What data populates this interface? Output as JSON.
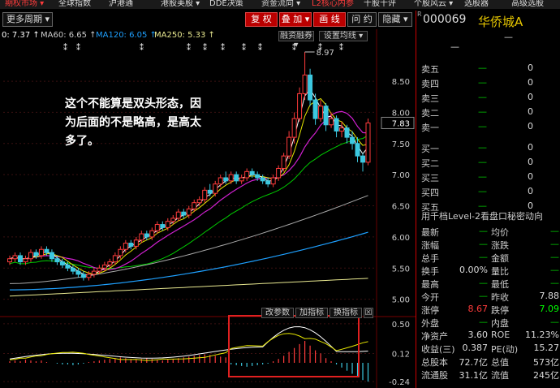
{
  "menu": [
    "期权市场 ▾",
    "全球指数",
    "沪港通",
    "港股美股 ▾",
    "DDE决策",
    "资金流向 ▾",
    "L2核心内参",
    "千股千评",
    "个股风云 ▾",
    "选股器",
    "高级选股"
  ],
  "toolbar": {
    "period": "更多周期 ▾",
    "restore": "复 权",
    "overlay": "叠 加 ▾",
    "draw": "画 线",
    "ask": "问 约",
    "hide": "隐藏 ▾"
  },
  "ma_legend": [
    {
      "label": "0: 7.37 ↑",
      "color": "#ffffff"
    },
    {
      "label": "MA60: 6.65 ↑",
      "color": "#cccccc"
    },
    {
      "label": "MA120: 6.05 ↑",
      "color": "#1ea0ff"
    },
    {
      "label": "MA250: 5.33 ↑",
      "color": "#e8e890"
    }
  ],
  "chart_buttons": {
    "margin": "融资融券 ▾",
    "ma_setting": "设置均线 ▾"
  },
  "sub_buttons": {
    "change_param": "改参数",
    "add_indicator": "加指标",
    "switch_indicator": "换指标",
    "close": "☒"
  },
  "chart_data": {
    "type": "candlestick",
    "price_axis_ticks": [
      8.5,
      8.0,
      7.5,
      7.0,
      6.5,
      6.0,
      5.5,
      5.0
    ],
    "current_price_label": "7.83",
    "high_label": "8.97",
    "macd_axis_ticks": [
      0.5,
      0.12,
      -0.24
    ],
    "candles": [
      [
        5.6,
        5.65,
        5.55,
        5.7
      ],
      [
        5.65,
        5.7,
        5.6,
        5.75
      ],
      [
        5.7,
        5.6,
        5.55,
        5.75
      ],
      [
        5.6,
        5.65,
        5.55,
        5.7
      ],
      [
        5.65,
        5.75,
        5.6,
        5.8
      ],
      [
        5.75,
        5.7,
        5.65,
        5.8
      ],
      [
        5.7,
        5.8,
        5.65,
        5.85
      ],
      [
        5.8,
        5.75,
        5.7,
        5.85
      ],
      [
        5.75,
        5.65,
        5.6,
        5.8
      ],
      [
        5.65,
        5.6,
        5.55,
        5.7
      ],
      [
        5.6,
        5.55,
        5.5,
        5.65
      ],
      [
        5.55,
        5.5,
        5.45,
        5.6
      ],
      [
        5.5,
        5.45,
        5.4,
        5.55
      ],
      [
        5.45,
        5.4,
        5.35,
        5.5
      ],
      [
        5.4,
        5.35,
        5.3,
        5.45
      ],
      [
        5.35,
        5.4,
        5.3,
        5.45
      ],
      [
        5.4,
        5.45,
        5.35,
        5.5
      ],
      [
        5.45,
        5.5,
        5.4,
        5.55
      ],
      [
        5.5,
        5.55,
        5.45,
        5.6
      ],
      [
        5.55,
        5.6,
        5.5,
        5.65
      ],
      [
        5.6,
        5.7,
        5.55,
        5.75
      ],
      [
        5.7,
        5.8,
        5.65,
        5.85
      ],
      [
        5.8,
        5.9,
        5.75,
        5.95
      ],
      [
        5.9,
        5.85,
        5.8,
        5.95
      ],
      [
        5.85,
        5.95,
        5.8,
        6.0
      ],
      [
        5.95,
        6.05,
        5.9,
        6.1
      ],
      [
        6.05,
        6.0,
        5.95,
        6.1
      ],
      [
        6.0,
        6.1,
        5.95,
        6.15
      ],
      [
        6.1,
        6.2,
        6.05,
        6.25
      ],
      [
        6.2,
        6.15,
        6.1,
        6.25
      ],
      [
        6.15,
        6.25,
        6.1,
        6.3
      ],
      [
        6.25,
        6.3,
        6.2,
        6.35
      ],
      [
        6.3,
        6.4,
        6.25,
        6.45
      ],
      [
        6.4,
        6.35,
        6.3,
        6.45
      ],
      [
        6.35,
        6.45,
        6.3,
        6.5
      ],
      [
        6.45,
        6.55,
        6.4,
        6.6
      ],
      [
        6.55,
        6.6,
        6.5,
        6.65
      ],
      [
        6.6,
        6.75,
        6.55,
        6.8
      ],
      [
        6.75,
        6.7,
        6.65,
        6.85
      ],
      [
        6.7,
        6.85,
        6.65,
        6.9
      ],
      [
        6.85,
        6.95,
        6.8,
        7.0
      ],
      [
        6.95,
        6.9,
        6.85,
        7.05
      ],
      [
        6.9,
        7.0,
        6.85,
        7.05
      ],
      [
        7.0,
        6.9,
        6.85,
        7.05
      ],
      [
        6.9,
        6.95,
        6.85,
        7.0
      ],
      [
        6.95,
        7.05,
        6.9,
        7.1
      ],
      [
        7.05,
        7.0,
        6.95,
        7.1
      ],
      [
        7.0,
        6.95,
        6.9,
        7.05
      ],
      [
        6.95,
        6.9,
        6.85,
        7.0
      ],
      [
        6.9,
        6.85,
        6.8,
        6.95
      ],
      [
        6.85,
        6.95,
        6.8,
        7.0
      ],
      [
        6.95,
        7.1,
        6.9,
        7.15
      ],
      [
        7.1,
        7.3,
        7.05,
        7.35
      ],
      [
        7.3,
        7.6,
        7.25,
        7.7
      ],
      [
        7.6,
        7.9,
        7.5,
        8.0
      ],
      [
        7.9,
        8.3,
        7.85,
        8.4
      ],
      [
        8.3,
        8.6,
        8.2,
        8.97
      ],
      [
        8.6,
        8.2,
        8.1,
        8.7
      ],
      [
        8.2,
        7.9,
        7.8,
        8.3
      ],
      [
        7.9,
        8.1,
        7.85,
        8.2
      ],
      [
        8.1,
        7.8,
        7.7,
        8.15
      ],
      [
        7.8,
        7.9,
        7.75,
        8.0
      ],
      [
        7.9,
        7.7,
        7.6,
        7.95
      ],
      [
        7.7,
        7.75,
        7.6,
        7.85
      ],
      [
        7.75,
        7.6,
        7.5,
        7.8
      ],
      [
        7.6,
        7.5,
        7.4,
        7.7
      ],
      [
        7.5,
        7.3,
        7.2,
        7.6
      ],
      [
        7.3,
        7.2,
        7.05,
        7.35
      ],
      [
        7.2,
        7.83,
        7.15,
        7.9
      ]
    ],
    "macd_bars": [
      0.02,
      0.03,
      0.02,
      0.04,
      0.03,
      0.02,
      0.03,
      0.01,
      0.0,
      -0.01,
      -0.02,
      -0.02,
      -0.03,
      -0.02,
      -0.01,
      0.01,
      0.02,
      0.03,
      0.04,
      0.05,
      0.06,
      0.07,
      0.06,
      0.05,
      0.04,
      0.05,
      0.06,
      0.05,
      0.04,
      0.03,
      0.04,
      0.05,
      0.06,
      0.07,
      0.08,
      0.09,
      0.1,
      0.11,
      0.1,
      0.09,
      0.08,
      0.07,
      -0.02,
      -0.03,
      -0.04,
      -0.05,
      -0.04,
      -0.03,
      -0.02,
      -0.01,
      0.02,
      0.05,
      0.09,
      0.14,
      0.19,
      0.24,
      0.28,
      0.22,
      0.16,
      0.12,
      0.06,
      0.02,
      -0.02,
      -0.06,
      -0.1,
      -0.14,
      -0.18,
      -0.22,
      -0.24
    ]
  },
  "annotation": "这个不能算是双头形态，因为后面的不是略高，是高太多了。",
  "quote": {
    "code_prefix": "R",
    "code": "000069",
    "name": "华侨城A",
    "dash": "—",
    "order_book": [
      {
        "label": "卖五",
        "dash": "—",
        "value": "0"
      },
      {
        "label": "卖四",
        "dash": "—",
        "value": "0"
      },
      {
        "label": "卖三",
        "dash": "—",
        "value": "0"
      },
      {
        "label": "卖二",
        "dash": "—",
        "value": "0"
      },
      {
        "label": "卖一",
        "dash": "—",
        "value": "0"
      },
      {
        "label": "买一",
        "dash": "—",
        "value": "0"
      },
      {
        "label": "买二",
        "dash": "—",
        "value": "0"
      },
      {
        "label": "买三",
        "dash": "—",
        "value": "0"
      },
      {
        "label": "买四",
        "dash": "—",
        "value": "0"
      },
      {
        "label": "买五",
        "dash": "—",
        "value": "0"
      }
    ],
    "l2_link": "用千档Level-2看盘口秘密动向",
    "stats": [
      {
        "a": "最新",
        "av": "—",
        "b": "均价",
        "bv": "—"
      },
      {
        "a": "涨幅",
        "av": "—",
        "b": "涨跌",
        "bv": "—"
      },
      {
        "a": "总手",
        "av": "—",
        "b": "金额",
        "bv": "—"
      },
      {
        "a": "换手",
        "av": "0.00%",
        "b": "量比",
        "bv": "—"
      },
      {
        "a": "最高",
        "av": "—",
        "b": "最低",
        "bv": "—"
      },
      {
        "a": "今开",
        "av": "—",
        "b": "昨收",
        "bv": "7.88"
      },
      {
        "a": "涨停",
        "av": "8.67",
        "b": "跌停",
        "bv": "7.09"
      },
      {
        "a": "外盘",
        "av": "—",
        "b": "内盘",
        "bv": "—"
      },
      {
        "a": "净资产",
        "av": "3.60",
        "b": "ROE",
        "bv": "11.23%"
      },
      {
        "a": "收益(三)",
        "av": "0.387",
        "b": "PE(动)",
        "bv": "15.27"
      },
      {
        "a": "总股本",
        "av": "72.7亿",
        "b": "总值",
        "bv": "573亿"
      },
      {
        "a": "流通股",
        "av": "31.1亿",
        "b": "流值",
        "bv": "245亿"
      }
    ],
    "colors": {
      "up": "#ff3b3b",
      "down": "#00c000",
      "name": "#e8c800",
      "accent_border": "#cc0000"
    }
  }
}
